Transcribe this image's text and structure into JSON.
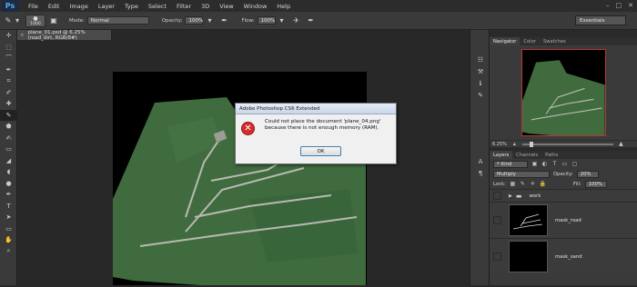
{
  "menu": {
    "logo": "Ps",
    "items": [
      "File",
      "Edit",
      "Image",
      "Layer",
      "Type",
      "Select",
      "Filter",
      "3D",
      "View",
      "Window",
      "Help"
    ]
  },
  "options": {
    "brush_size": "1000",
    "mode_label": "Mode:",
    "mode_value": "Normal",
    "opacity_label": "Opacity:",
    "opacity_value": "100%",
    "flow_label": "Flow:",
    "flow_value": "100%",
    "workspace": "Essentials"
  },
  "document": {
    "tab_title": "plane_01.psd @ 6.25% (road_dirt, RGB/8#)"
  },
  "panels": {
    "top_tabs": [
      "Navigator",
      "Color",
      "Swatches"
    ],
    "zoom": "6.25%",
    "layer_tabs": [
      "Layers",
      "Channels",
      "Paths"
    ],
    "kind_label": "Kind",
    "blend_mode": "Multiply",
    "opacity_label": "Opacity:",
    "opacity_value": "20%",
    "lock_label": "Lock:",
    "fill_label": "Fill:",
    "fill_value": "100%",
    "layers": [
      {
        "name": "work",
        "type": "group"
      },
      {
        "name": "mask_road",
        "type": "layer"
      },
      {
        "name": "mask_sand",
        "type": "layer"
      }
    ]
  },
  "dialog": {
    "title": "Adobe Photoshop CS6 Extended",
    "message_line1": "Could not place the document 'plane_04.png'",
    "message_line2": "because there is not enough memory (RAM).",
    "ok_label": "OK"
  },
  "colors": {
    "terrain": "#3f6b3e",
    "road": "#b9b9b0",
    "error_icon": "#d42d2d",
    "nav_border": "#b33333"
  }
}
